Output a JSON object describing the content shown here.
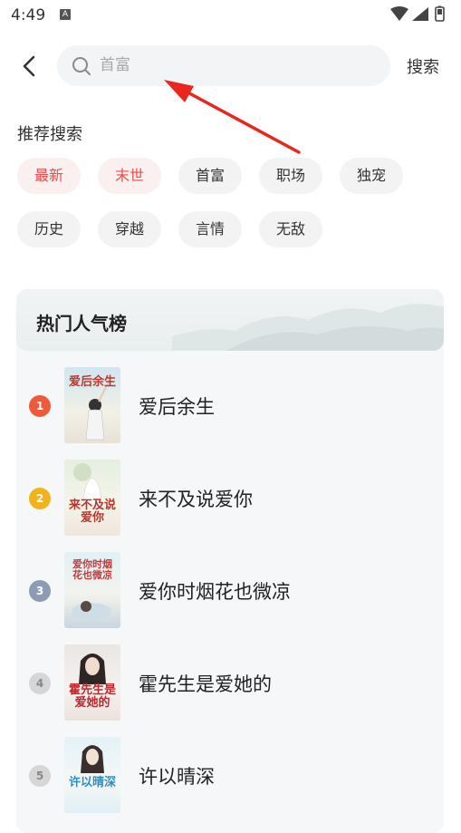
{
  "status": {
    "time": "4:49",
    "notification_icon": "A"
  },
  "search": {
    "placeholder": "首富",
    "button_label": "搜索"
  },
  "recommend": {
    "title": "推荐搜索",
    "tags": [
      {
        "label": "最新",
        "hot": true
      },
      {
        "label": "末世",
        "hot": true
      },
      {
        "label": "首富",
        "hot": false
      },
      {
        "label": "职场",
        "hot": false
      },
      {
        "label": "独宠",
        "hot": false
      },
      {
        "label": "历史",
        "hot": false
      },
      {
        "label": "穿越",
        "hot": false
      },
      {
        "label": "言情",
        "hot": false
      },
      {
        "label": "无敌",
        "hot": false
      }
    ]
  },
  "ranking": {
    "title": "热门人气榜",
    "items": [
      {
        "rank": "1",
        "title": "爱后余生",
        "cover_text": "爱后余生",
        "badge_color": "#ee5a3c"
      },
      {
        "rank": "2",
        "title": "来不及说爱你",
        "cover_text": "来不及说爱你",
        "badge_color": "#f2b21b"
      },
      {
        "rank": "3",
        "title": "爱你时烟花也微凉",
        "cover_text": "爱你时烟花也微凉",
        "badge_color": "#8c9cb4"
      },
      {
        "rank": "4",
        "title": "霍先生是爱她的",
        "cover_text": "霍先生是爱她的",
        "badge_color": "#d6d6d6"
      },
      {
        "rank": "5",
        "title": "许以晴深",
        "cover_text": "许以晴深",
        "badge_color": "#d6d6d6"
      }
    ]
  },
  "colors": {
    "accent_red": "#ee4d4d",
    "annotation_arrow": "#e8281f"
  }
}
